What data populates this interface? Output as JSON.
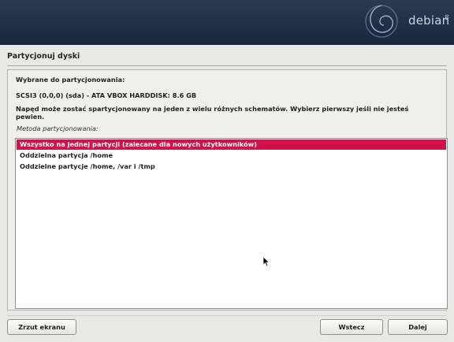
{
  "banner": {
    "logo_text": "debian",
    "logo_version": "8"
  },
  "page": {
    "title": "Partycjonuj dyski"
  },
  "content": {
    "selected_heading": "Wybrane do partycjonowania:",
    "disk": "SCSI3 (0,0,0) (sda) - ATA VBOX HARDDISK: 8.6 GB",
    "description": "Napęd może zostać spartycjonowany na jeden z wielu różnych schematów. Wybierz pierwszy jeśli nie jesteś pewien.",
    "method_label": "Metoda partycjonowania:"
  },
  "methods": {
    "selected_index": 0,
    "items": [
      {
        "label": "Wszystko na jednej partycji (zalecane dla nowych użytkowników)"
      },
      {
        "label": "Oddzielna partycja /home"
      },
      {
        "label": "Oddzielne partycje /home, /var i /tmp"
      }
    ]
  },
  "footer": {
    "screenshot_label": "Zrzut ekranu",
    "back_label": "Wstecz",
    "continue_label": "Dalej"
  },
  "colors": {
    "banner": "#1d2c44",
    "selection": "#d1124a",
    "background": "#e8e8e6"
  }
}
